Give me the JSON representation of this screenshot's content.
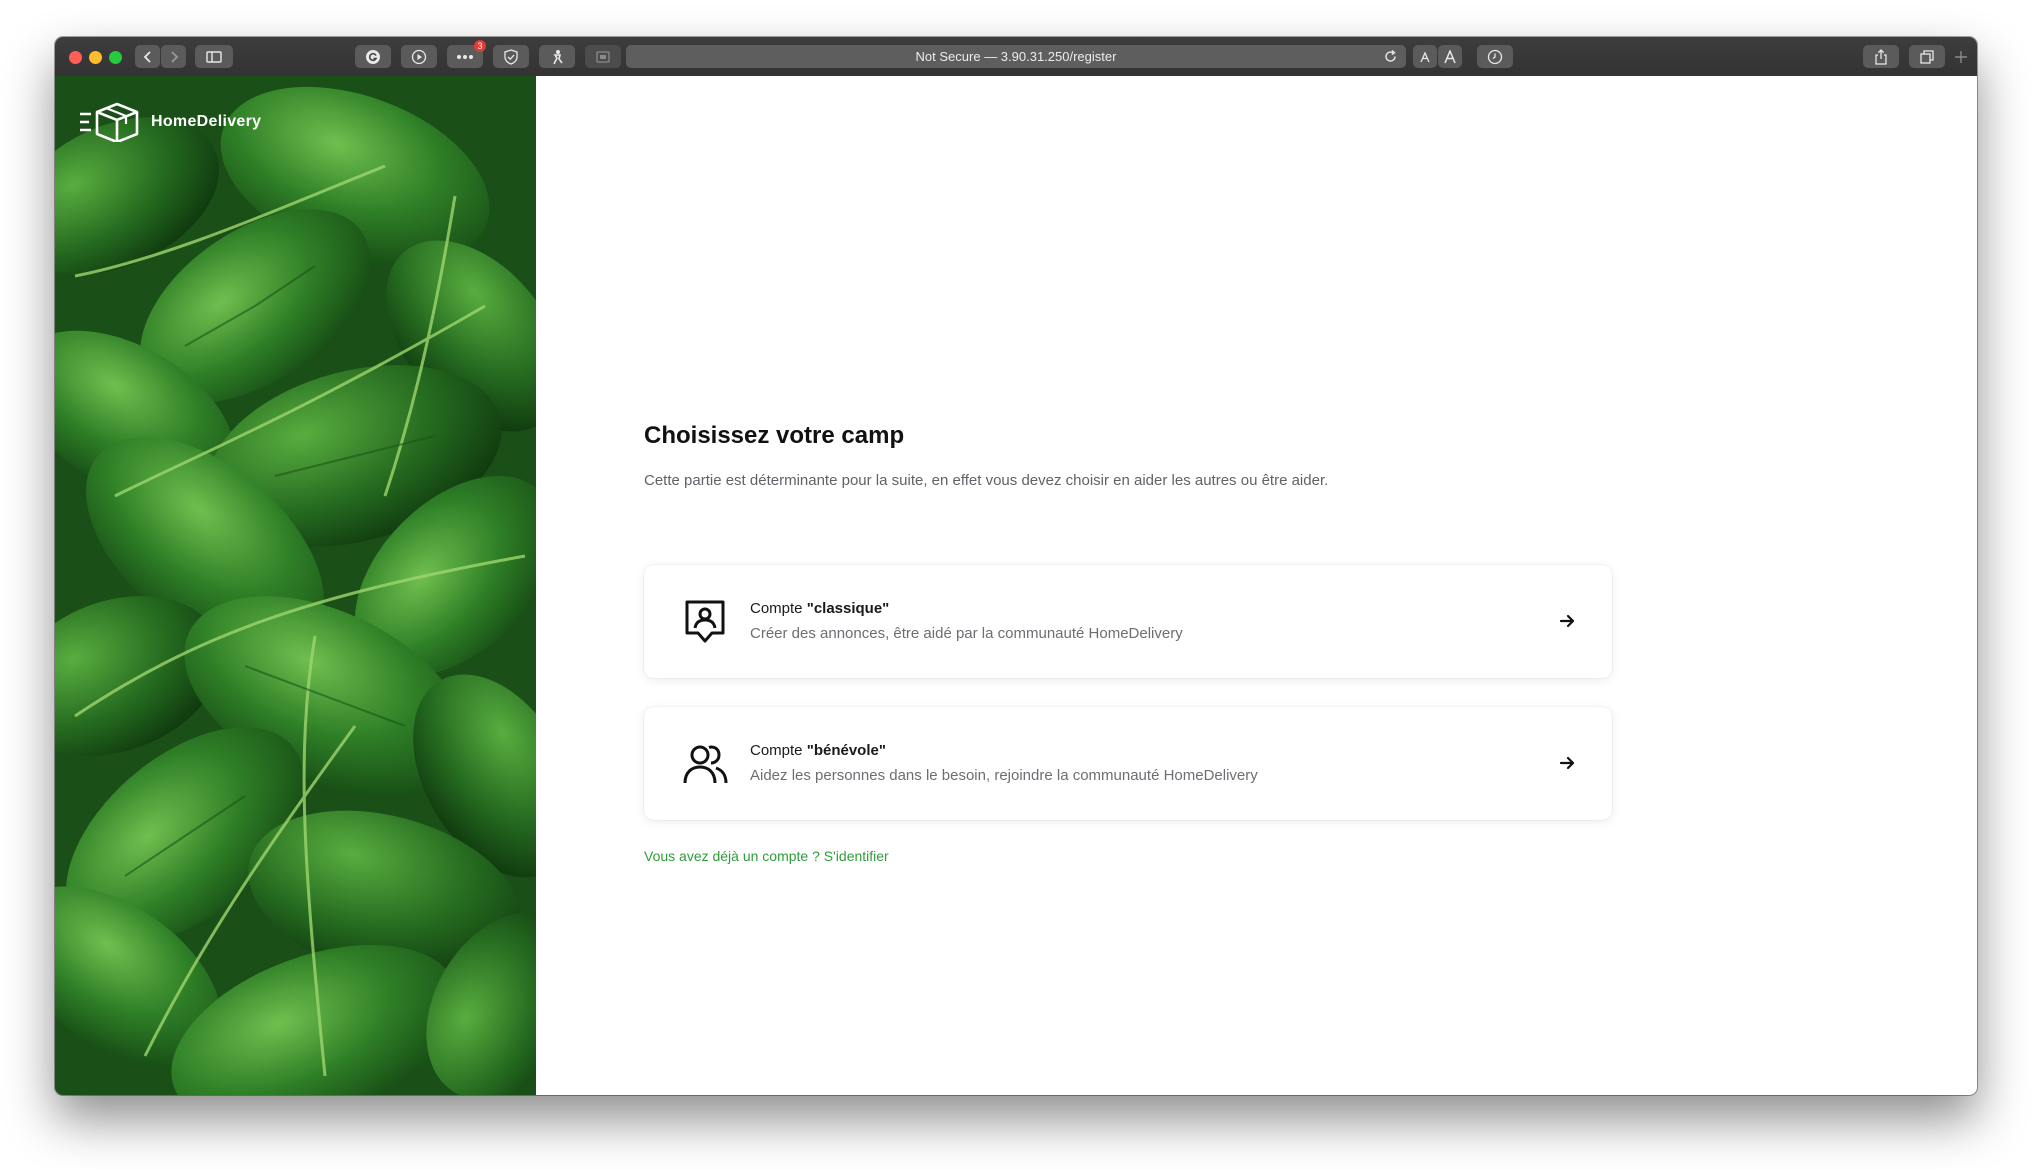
{
  "browser": {
    "url_text": "Not Secure — 3.90.31.250/register",
    "extension_badge_count": "3"
  },
  "brand": {
    "name": "HomeDelivery"
  },
  "register": {
    "title": "Choisissez votre camp",
    "subtitle": "Cette partie est déterminante pour la suite, en effet vous devez choisir en aider les autres ou être aider.",
    "options": [
      {
        "prefix": "Compte ",
        "name": "\"classique\"",
        "description": "Créer des annonces, être aidé par la communauté HomeDelivery",
        "icon": "user-badge-icon"
      },
      {
        "prefix": "Compte ",
        "name": "\"bénévole\"",
        "description": "Aidez les personnes dans le besoin, rejoindre la communauté HomeDelivery",
        "icon": "users-group-icon"
      }
    ],
    "login_link": "Vous avez déjà un compte ? S'identifier"
  },
  "colors": {
    "accent_green": "#2e9c3a",
    "toolbar": "#3a3a3a"
  }
}
